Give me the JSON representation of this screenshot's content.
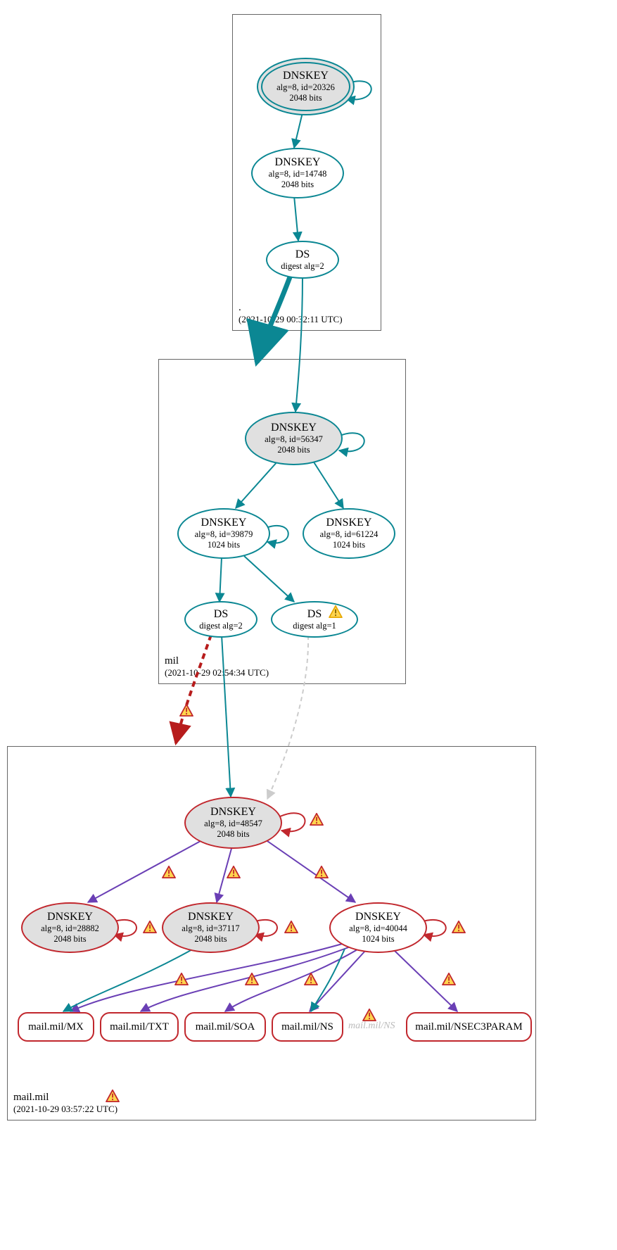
{
  "zones": {
    "root": {
      "name": ".",
      "timestamp": "(2021-10-29 00:32:11 UTC)"
    },
    "mil": {
      "name": "mil",
      "timestamp": "(2021-10-29 02:54:34 UTC)"
    },
    "mailmil": {
      "name": "mail.mil",
      "timestamp": "(2021-10-29 03:57:22 UTC)"
    }
  },
  "nodes": {
    "root_dnskey_20326": {
      "title": "DNSKEY",
      "line1": "alg=8, id=20326",
      "line2": "2048 bits"
    },
    "root_dnskey_14748": {
      "title": "DNSKEY",
      "line1": "alg=8, id=14748",
      "line2": "2048 bits"
    },
    "root_ds": {
      "title": "DS",
      "line1": "digest alg=2"
    },
    "mil_dnskey_56347": {
      "title": "DNSKEY",
      "line1": "alg=8, id=56347",
      "line2": "2048 bits"
    },
    "mil_dnskey_39879": {
      "title": "DNSKEY",
      "line1": "alg=8, id=39879",
      "line2": "1024 bits"
    },
    "mil_dnskey_61224": {
      "title": "DNSKEY",
      "line1": "alg=8, id=61224",
      "line2": "1024 bits"
    },
    "mil_ds2": {
      "title": "DS",
      "line1": "digest alg=2"
    },
    "mil_ds1": {
      "title": "DS",
      "line1": "digest alg=1"
    },
    "mm_dnskey_48547": {
      "title": "DNSKEY",
      "line1": "alg=8, id=48547",
      "line2": "2048 bits"
    },
    "mm_dnskey_28882": {
      "title": "DNSKEY",
      "line1": "alg=8, id=28882",
      "line2": "2048 bits"
    },
    "mm_dnskey_37117": {
      "title": "DNSKEY",
      "line1": "alg=8, id=37117",
      "line2": "2048 bits"
    },
    "mm_dnskey_40044": {
      "title": "DNSKEY",
      "line1": "alg=8, id=40044",
      "line2": "1024 bits"
    },
    "mm_mx": "mail.mil/MX",
    "mm_txt": "mail.mil/TXT",
    "mm_soa": "mail.mil/SOA",
    "mm_ns": "mail.mil/NS",
    "mm_ns_ghost": "mail.mil/NS",
    "mm_nsec3": "mail.mil/NSEC3PARAM"
  },
  "colors": {
    "teal": "#0b8793",
    "red": "#c1272d",
    "purple": "#6a3fb5",
    "gray": "#cccccc"
  }
}
